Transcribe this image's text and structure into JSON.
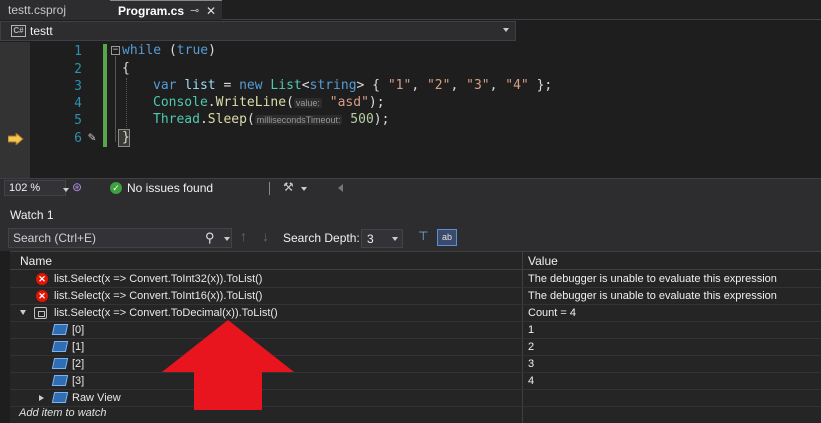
{
  "tabs": [
    {
      "label": "testt.csproj"
    },
    {
      "label": "Program.cs"
    }
  ],
  "navbar": {
    "project": "testt",
    "icon_text": "C#"
  },
  "editor": {
    "line_numbers": [
      "1",
      "2",
      "3",
      "4",
      "5",
      "6"
    ],
    "lines": {
      "l1_kw": "while",
      "l1_rest": " (",
      "l1_true": "true",
      "l1_close": ")",
      "l2": "{",
      "l3_var": "var",
      "l3_list": "list",
      "l3_eq": " = ",
      "l3_new": "new",
      "l3_type": "List",
      "l3_lt": "<",
      "l3_string": "string",
      "l3_gt": "> { ",
      "l3_s1": "\"1\"",
      "l3_c1": ", ",
      "l3_s2": "\"2\"",
      "l3_c2": ", ",
      "l3_s3": "\"3\"",
      "l3_c3": ", ",
      "l3_s4": "\"4\"",
      "l3_end": " };",
      "l4_cls": "Console",
      "l4_dot": ".",
      "l4_m": "WriteLine",
      "l4_op": "(",
      "l4_hint": "value:",
      "l4_arg": "\"asd\"",
      "l4_end": ");",
      "l5_cls": "Thread",
      "l5_dot": ".",
      "l5_m": "Sleep",
      "l5_op": "(",
      "l5_hint": "millisecondsTimeout:",
      "l5_arg": "500",
      "l5_end": ");",
      "l6": "}"
    }
  },
  "status": {
    "zoom": "102 %",
    "issues": "No issues found"
  },
  "watch": {
    "title": "Watch 1",
    "search_placeholder": "Search (Ctrl+E)",
    "depth_label": "Search Depth:",
    "depth_value": "3",
    "columns": {
      "name": "Name",
      "value": "Value"
    },
    "rows": [
      {
        "name": "list.Select(x => Convert.ToInt32(x)).ToList()",
        "value": "The debugger is unable to evaluate this expression"
      },
      {
        "name": "list.Select(x => Convert.ToInt16(x)).ToList()",
        "value": "The debugger is unable to evaluate this expression"
      },
      {
        "name": "list.Select(x => Convert.ToDecimal(x)).ToList()",
        "value": "Count = 4"
      },
      {
        "name": "[0]",
        "value": "1"
      },
      {
        "name": "[1]",
        "value": "2"
      },
      {
        "name": "[2]",
        "value": "3"
      },
      {
        "name": "[3]",
        "value": "4"
      },
      {
        "name": "Raw View",
        "value": ""
      }
    ],
    "add_item": "Add item to watch"
  },
  "colors": {
    "accent_arrow": "#e8141e",
    "change_bar": "#57a64a",
    "error": "#e51400"
  }
}
